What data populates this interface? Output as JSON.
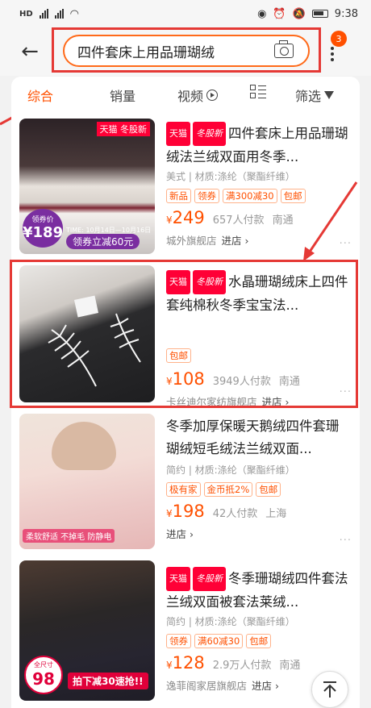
{
  "status": {
    "net": "HD",
    "time": "9:38"
  },
  "search": {
    "query": "四件套床上用品珊瑚绒",
    "badge": "3"
  },
  "tabs": [
    {
      "label": "综合"
    },
    {
      "label": "销量"
    },
    {
      "label": "视频"
    },
    {
      "label": "筛选"
    }
  ],
  "products": [
    {
      "tags": [
        "天猫",
        "冬股新"
      ],
      "title": "四件套床上用品珊瑚绒法兰绒双面用冬季...",
      "attrs": "美式 | 材质:涤纶（聚酯纤维）",
      "services": [
        "新品",
        "领券",
        "满300减30",
        "包邮"
      ],
      "price": "249",
      "sales": "657人付款",
      "place": "南通",
      "shop": "城外旗舰店",
      "enter": "进店 ›",
      "image_texts": {
        "brand": "天猫 冬股新",
        "promo_price": "189",
        "promo_label": "领券价",
        "time": "TIME: 10月14日—10月16日",
        "coupon": "领券立减60元"
      }
    },
    {
      "tags": [
        "天猫",
        "冬股新"
      ],
      "title": "水晶珊瑚绒床上四件套纯棉秋冬季宝宝法...",
      "attrs": "",
      "services": [
        "包邮"
      ],
      "price": "108",
      "sales": "3949人付款",
      "place": "南通",
      "shop": "卡丝迪尔家纺旗舰店",
      "enter": "进店 ›"
    },
    {
      "tags": [],
      "title": "冬季加厚保暖天鹅绒四件套珊瑚绒短毛绒法兰绒双面...",
      "attrs": "简约 | 材质:涤纶（聚酯纤维）",
      "services": [
        "极有家",
        "金币抵2%",
        "包邮"
      ],
      "price": "198",
      "sales": "42人付款",
      "place": "上海",
      "shop": "",
      "enter": "进店 ›",
      "image_texts": {
        "features": "柔软舒适  不掉毛  防静电"
      }
    },
    {
      "tags": [
        "天猫",
        "冬股新"
      ],
      "title": "冬季珊瑚绒四件套法兰绒双面被套法莱绒...",
      "attrs": "简约 | 材质:涤纶（聚酯纤维）",
      "services": [
        "领券",
        "满60减30",
        "包邮"
      ],
      "price": "128",
      "sales": "2.9万人付款",
      "place": "南通",
      "shop": "逸菲阁家居旗舰店",
      "enter": "进店 ›",
      "image_texts": {
        "promo_price": "98",
        "promo_label": "全尺寸",
        "banner": "拍下减30速抢!!"
      }
    }
  ],
  "colors": {
    "accent": "#ff5000",
    "highlight": "#e53935"
  }
}
